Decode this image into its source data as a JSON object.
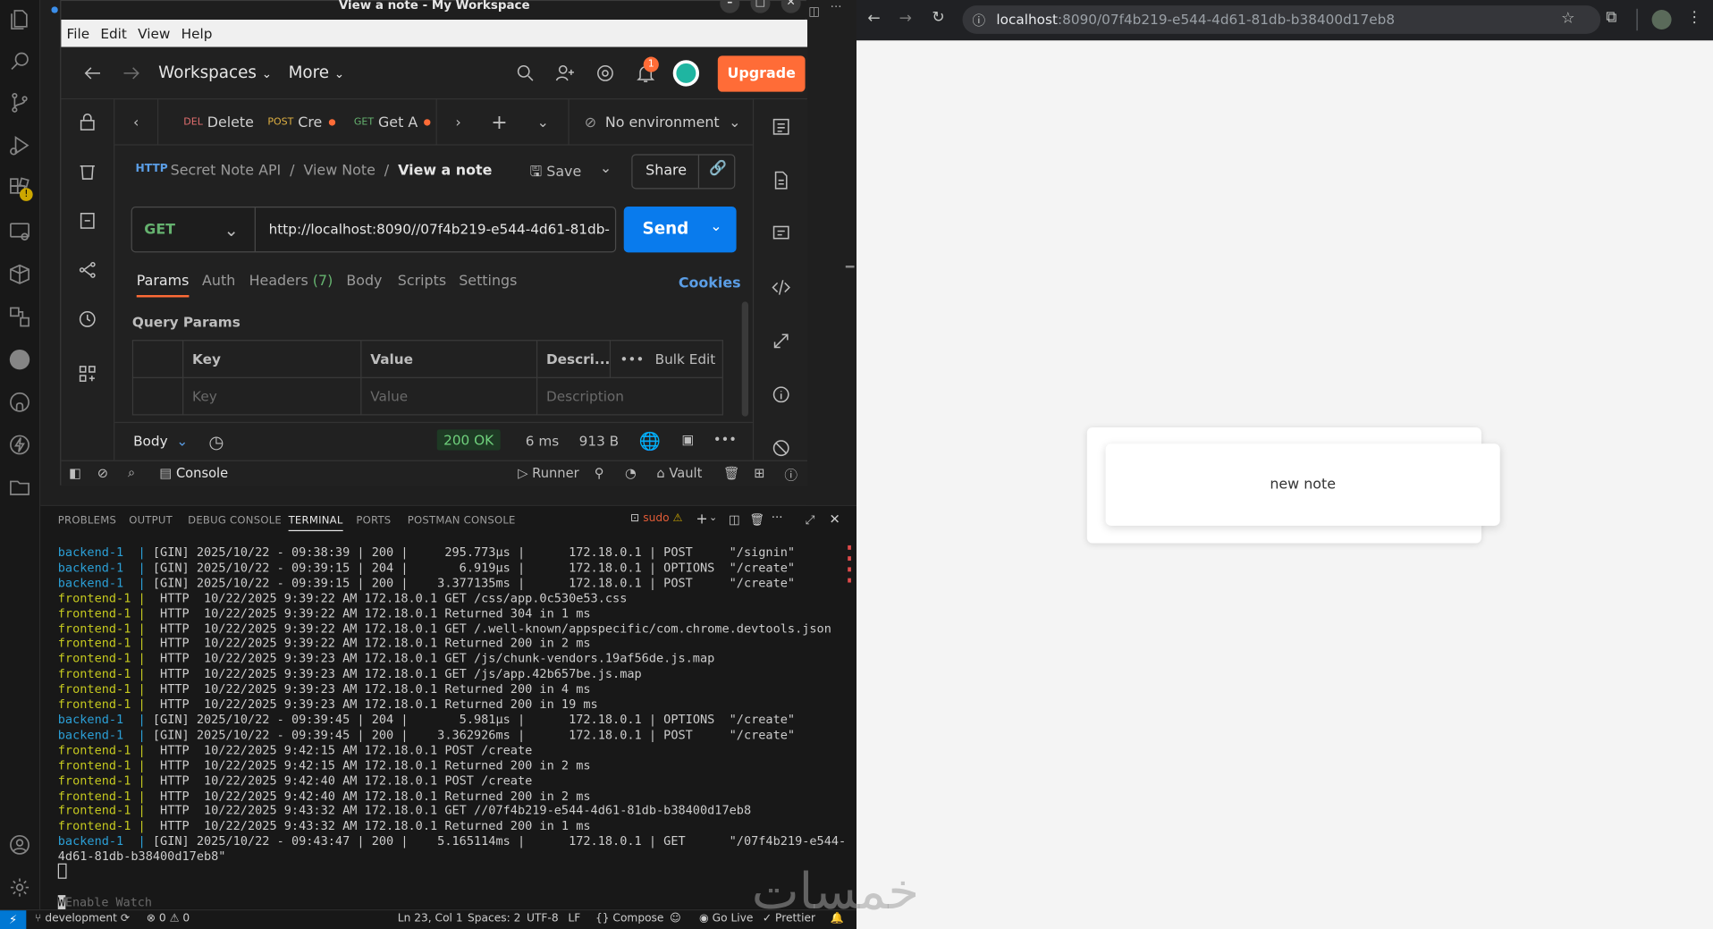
{
  "postman": {
    "window_title": "View a note - My Workspace",
    "menu": [
      "File",
      "Edit",
      "View",
      "Help"
    ],
    "header": {
      "workspaces_label": "Workspaces",
      "more_label": "More",
      "notification_count": "1",
      "upgrade_label": "Upgrade"
    },
    "tabs": [
      {
        "method": "DEL",
        "label": "Delete"
      },
      {
        "method": "POST",
        "label": "Cre"
      },
      {
        "method": "GET",
        "label": "Get A"
      }
    ],
    "environment": "No environment",
    "breadcrumb": {
      "root": "Secret Note API",
      "sep": "/",
      "folder": "View Note",
      "current": "View a note"
    },
    "save_label": "Save",
    "share_label": "Share",
    "request": {
      "method": "GET",
      "url": "http://localhost:8090//07f4b219-e544-4d61-81db-...",
      "send_label": "Send"
    },
    "subtabs": {
      "params": "Params",
      "auth": "Auth",
      "headers": "Headers",
      "headers_count": "(7)",
      "body": "Body",
      "scripts": "Scripts",
      "settings": "Settings",
      "cookies": "Cookies"
    },
    "query_params": {
      "title": "Query Params",
      "col_key": "Key",
      "col_value": "Value",
      "col_desc": "Descri...",
      "bulk_edit": "Bulk Edit",
      "ph_key": "Key",
      "ph_value": "Value",
      "ph_desc": "Description"
    },
    "response": {
      "body_label": "Body",
      "status": "200 OK",
      "time": "6 ms",
      "size": "913 B"
    },
    "footer": {
      "console": "Console",
      "runner": "Runner",
      "vault": "Vault"
    }
  },
  "panel": {
    "tabs": [
      "PROBLEMS",
      "OUTPUT",
      "DEBUG CONSOLE",
      "TERMINAL",
      "PORTS",
      "POSTMAN CONSOLE"
    ],
    "active_tab": "TERMINAL",
    "shell_label": "sudo",
    "terminal_lines": [
      {
        "svc": "backend-1",
        "sep": "  | ",
        "text": "[GIN] 2025/10/22 - 09:38:39 | 200 |     295.773µs |      172.18.0.1 | POST     \"/signin\""
      },
      {
        "svc": "backend-1",
        "sep": "  | ",
        "text": "[GIN] 2025/10/22 - 09:39:15 | 204 |       6.919µs |      172.18.0.1 | OPTIONS  \"/create\""
      },
      {
        "svc": "backend-1",
        "sep": "  | ",
        "text": "[GIN] 2025/10/22 - 09:39:15 | 200 |    3.377135ms |      172.18.0.1 | POST     \"/create\""
      },
      {
        "svc": "frontend-1",
        "sep": " |  ",
        "text": "HTTP  10/22/2025 9:39:22 AM 172.18.0.1 GET /css/app.0c530e53.css"
      },
      {
        "svc": "frontend-1",
        "sep": " |  ",
        "text": "HTTP  10/22/2025 9:39:22 AM 172.18.0.1 Returned 304 in 1 ms"
      },
      {
        "svc": "frontend-1",
        "sep": " |  ",
        "text": "HTTP  10/22/2025 9:39:22 AM 172.18.0.1 GET /.well-known/appspecific/com.chrome.devtools.json"
      },
      {
        "svc": "frontend-1",
        "sep": " |  ",
        "text": "HTTP  10/22/2025 9:39:22 AM 172.18.0.1 Returned 200 in 2 ms"
      },
      {
        "svc": "frontend-1",
        "sep": " |  ",
        "text": "HTTP  10/22/2025 9:39:23 AM 172.18.0.1 GET /js/chunk-vendors.19af56de.js.map"
      },
      {
        "svc": "frontend-1",
        "sep": " |  ",
        "text": "HTTP  10/22/2025 9:39:23 AM 172.18.0.1 GET /js/app.42b657be.js.map"
      },
      {
        "svc": "frontend-1",
        "sep": " |  ",
        "text": "HTTP  10/22/2025 9:39:23 AM 172.18.0.1 Returned 200 in 4 ms"
      },
      {
        "svc": "frontend-1",
        "sep": " |  ",
        "text": "HTTP  10/22/2025 9:39:23 AM 172.18.0.1 Returned 200 in 19 ms"
      },
      {
        "svc": "backend-1",
        "sep": "  | ",
        "text": "[GIN] 2025/10/22 - 09:39:45 | 204 |       5.981µs |      172.18.0.1 | OPTIONS  \"/create\""
      },
      {
        "svc": "backend-1",
        "sep": "  | ",
        "text": "[GIN] 2025/10/22 - 09:39:45 | 200 |    3.362926ms |      172.18.0.1 | POST     \"/create\""
      },
      {
        "svc": "frontend-1",
        "sep": " |  ",
        "text": "HTTP  10/22/2025 9:42:15 AM 172.18.0.1 POST /create"
      },
      {
        "svc": "frontend-1",
        "sep": " |  ",
        "text": "HTTP  10/22/2025 9:42:15 AM 172.18.0.1 Returned 200 in 2 ms"
      },
      {
        "svc": "frontend-1",
        "sep": " |  ",
        "text": "HTTP  10/22/2025 9:42:40 AM 172.18.0.1 POST /create"
      },
      {
        "svc": "frontend-1",
        "sep": " |  ",
        "text": "HTTP  10/22/2025 9:42:40 AM 172.18.0.1 Returned 200 in 2 ms"
      },
      {
        "svc": "frontend-1",
        "sep": " |  ",
        "text": "HTTP  10/22/2025 9:43:32 AM 172.18.0.1 GET //07f4b219-e544-4d61-81db-b38400d17eb8"
      },
      {
        "svc": "frontend-1",
        "sep": " |  ",
        "text": "HTTP  10/22/2025 9:43:32 AM 172.18.0.1 Returned 200 in 1 ms"
      },
      {
        "svc": "backend-1",
        "sep": "  | ",
        "text": "[GIN] 2025/10/22 - 09:43:47 | 200 |    5.165114ms |      172.18.0.1 | GET      \"/07f4b219-e544-"
      },
      {
        "svc": "",
        "sep": "",
        "text": "4d61-81db-b38400d17eb8\""
      }
    ],
    "enable_watch": "Enable Watch"
  },
  "statusbar": {
    "branch": "development",
    "problems": "0",
    "warnings": "0",
    "position": "Ln 23, Col 1",
    "spaces": "Spaces: 2",
    "encoding": "UTF-8",
    "eol": "LF",
    "compose": "Compose",
    "golive": "Go Live",
    "prettier": "Prettier"
  },
  "browser": {
    "url_host": "localhost",
    "url_rest": ":8090/07f4b219-e544-4d61-81db-b38400d17eb8",
    "note_text": "new note"
  },
  "watermark": "خمسات",
  "colors": {
    "postman_orange": "#ff6c37",
    "send_blue": "#097bed",
    "status_green": "#1e3a24",
    "backend_blue": "#2b9fd6",
    "frontend_yellow": "#c4c81f",
    "vscode_blue": "#0078d4"
  }
}
